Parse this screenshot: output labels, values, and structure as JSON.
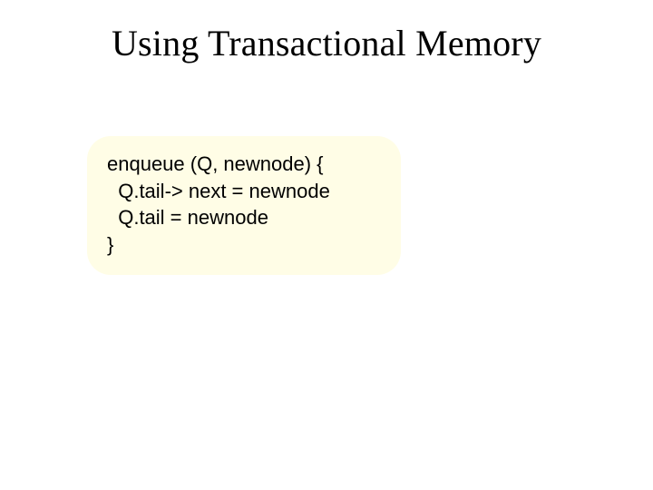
{
  "title": "Using Transactional Memory",
  "code": {
    "line1": "enqueue (Q, newnode) {",
    "line2": "  Q.tail-> next = newnode",
    "line3": "  Q.tail = newnode",
    "line4": "}"
  }
}
